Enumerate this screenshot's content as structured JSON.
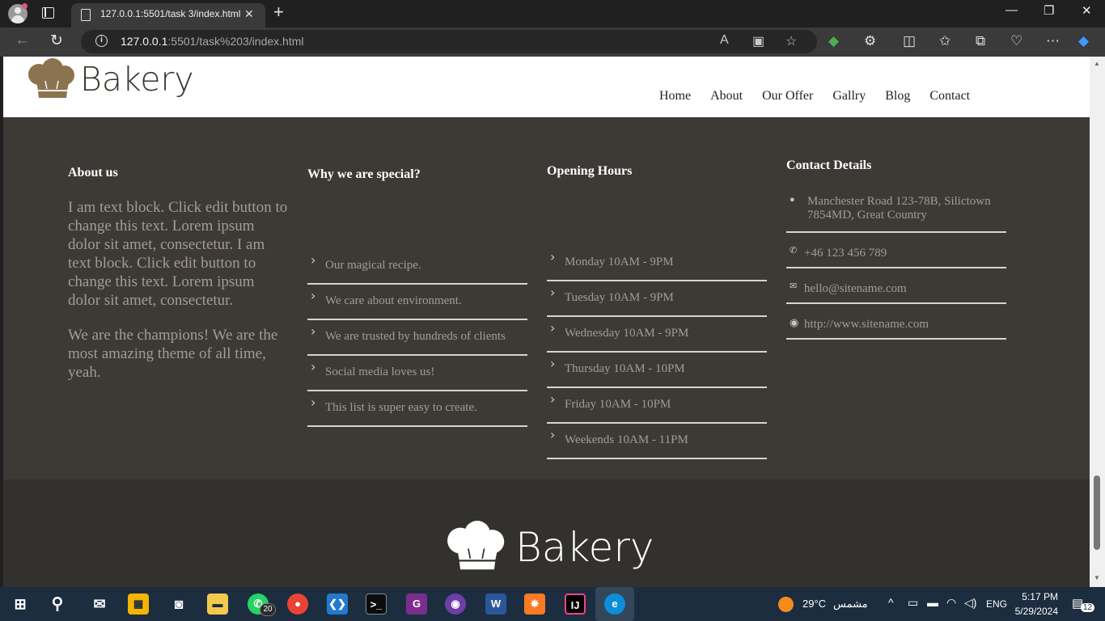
{
  "browser": {
    "tab_title": "127.0.0.1:5501/task 3/index.html",
    "url_host": "127.0.0.1",
    "url_rest": ":5501/task%203/index.html"
  },
  "site": {
    "brand": "Bakery",
    "nav": [
      "Home",
      "About",
      "Our Offer",
      "Gallry",
      "Blog",
      "Contact"
    ],
    "about": {
      "title": "About us",
      "p1": "I am text block. Click edit button to change this text. Lorem ipsum dolor sit amet, consectetur. I am text block. Click edit button to change this text. Lorem ipsum dolor sit amet, consectetur.",
      "p2": "We are the champions! We are the most amazing theme of all time, yeah."
    },
    "special": {
      "title": "Why we are special?",
      "items": [
        "Our magical recipe.",
        "We care about environment.",
        "We are trusted by hundreds of clients",
        "Social media loves us!",
        "This list is super easy to create."
      ]
    },
    "hours": {
      "title": "Opening Hours",
      "items": [
        "Monday 10AM - 9PM",
        "Tuesday 10AM - 9PM",
        "Wednesday 10AM - 9PM",
        "Thursday 10AM - 10PM",
        "Friday 10AM - 10PM",
        "Weekends 10AM - 11PM"
      ]
    },
    "contact": {
      "title": "Contact Details",
      "address": "Manchester Road 123-78B, Silictown 7854MD, Great Country",
      "phone": "+46 123 456 789",
      "email": "hello@sitename.com",
      "web": "http://www.sitename.com"
    },
    "colors": {
      "footer_bg": "#3d3a36",
      "bottom_bg": "#33312d",
      "text_muted": "#a39c8f",
      "logo_brown": "#8c7350"
    }
  },
  "taskbar": {
    "whatsapp_badge": "20",
    "weather_temp": "29°C",
    "weather_label": "مشمس",
    "lang": "ENG",
    "time": "5:17 PM",
    "date": "5/29/2024",
    "notifications": "12"
  }
}
